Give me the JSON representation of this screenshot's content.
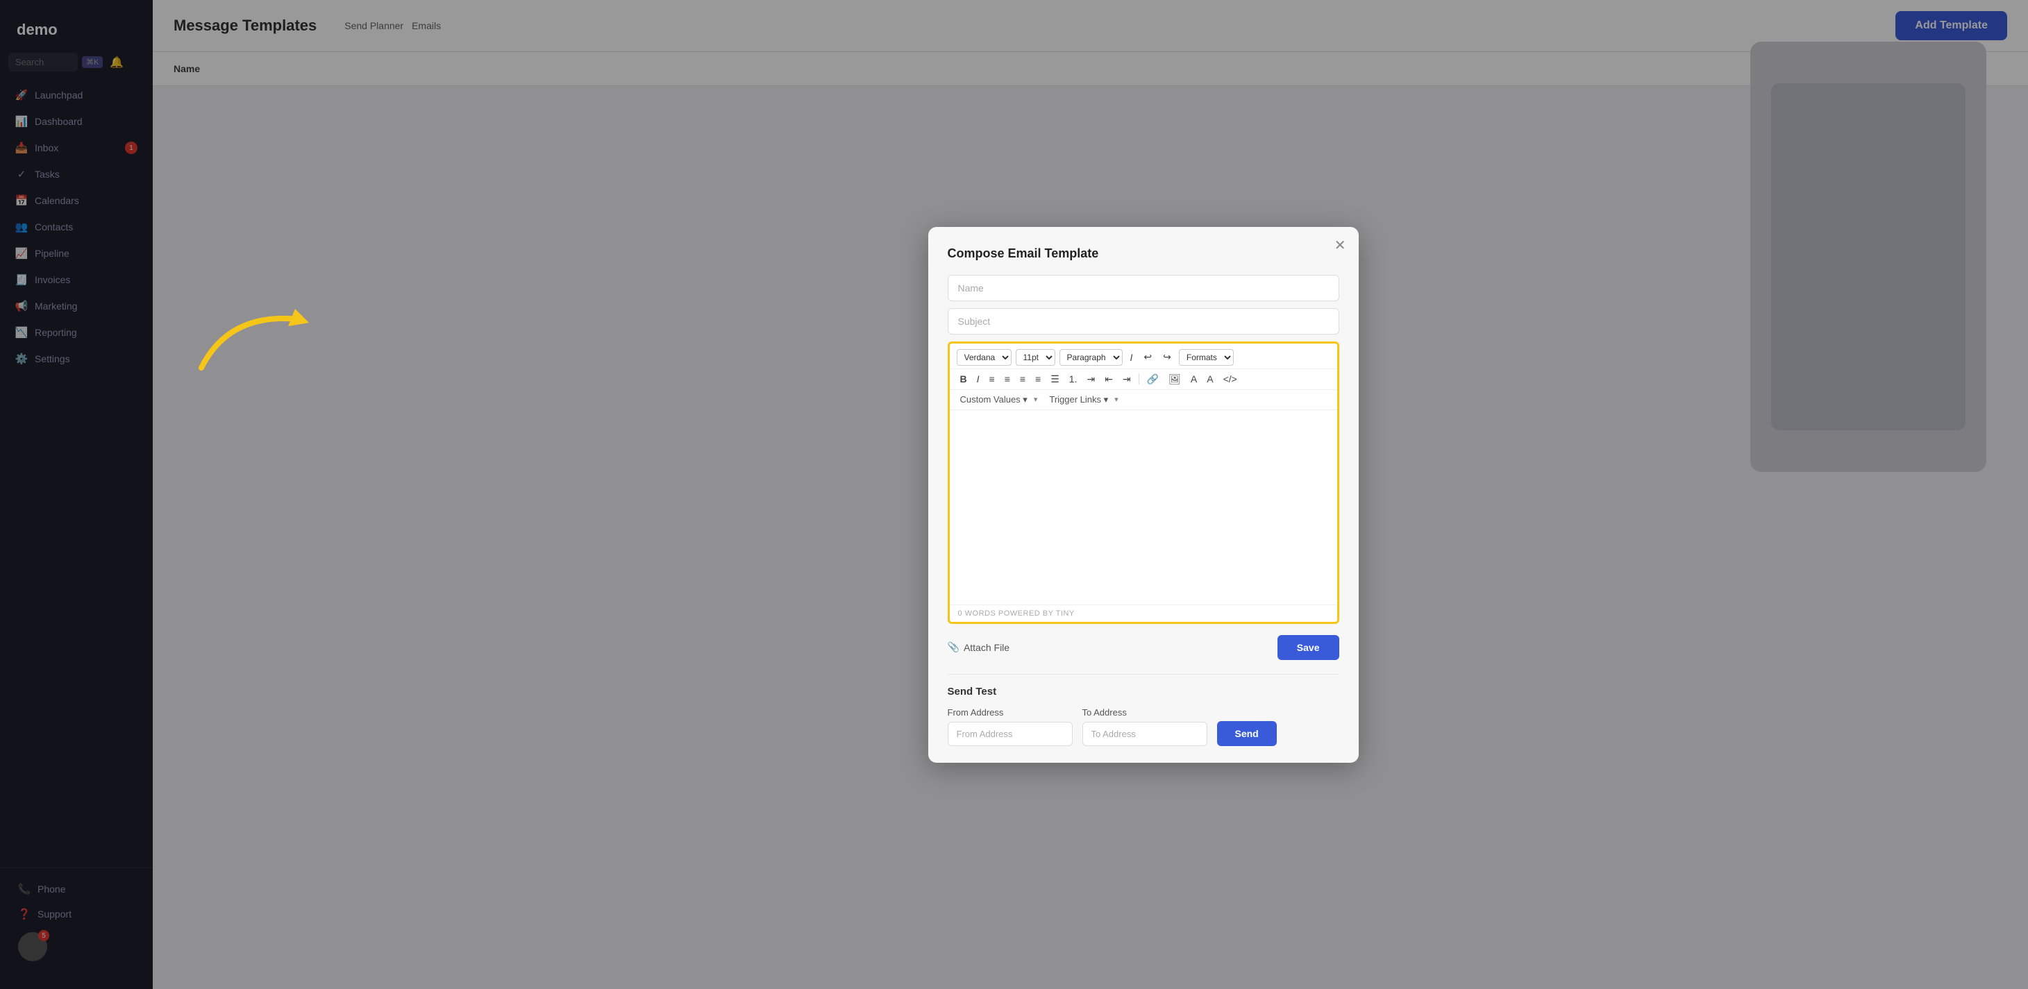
{
  "app": {
    "logo": "demo",
    "page_title": "Message Templates"
  },
  "sidebar": {
    "search_placeholder": "Search",
    "search_badge": "⌘K",
    "items": [
      {
        "id": "launchpad",
        "label": "Launchpad",
        "icon": "🚀"
      },
      {
        "id": "dashboard",
        "label": "Dashboard",
        "icon": "📊"
      },
      {
        "id": "inbox",
        "label": "Inbox",
        "icon": "📥",
        "badge": "1"
      },
      {
        "id": "tasks",
        "label": "Tasks",
        "icon": "✓"
      },
      {
        "id": "calendars",
        "label": "Calendars",
        "icon": "📅"
      },
      {
        "id": "contacts",
        "label": "Contacts",
        "icon": "👥"
      },
      {
        "id": "pipeline",
        "label": "Pipeline",
        "icon": "📈"
      },
      {
        "id": "invoices",
        "label": "Invoices",
        "icon": "🧾"
      },
      {
        "id": "marketing",
        "label": "Marketing",
        "icon": "📢"
      },
      {
        "id": "reporting",
        "label": "Reporting",
        "icon": "📉"
      },
      {
        "id": "settings",
        "label": "Settings",
        "icon": "⚙️"
      }
    ],
    "bottom_items": [
      {
        "id": "phone",
        "label": "Phone",
        "icon": "📞"
      },
      {
        "id": "support",
        "label": "Support",
        "icon": "❓"
      }
    ],
    "avatar_badge": "5"
  },
  "header": {
    "title": "Message Templates",
    "nav": [
      "Send Planner",
      "Emails"
    ],
    "add_button_label": "Add Template"
  },
  "table": {
    "columns": [
      "Name"
    ]
  },
  "modal": {
    "title": "Compose Email Template",
    "name_placeholder": "Name",
    "subject_placeholder": "Subject",
    "toolbar": {
      "font": "Verdana",
      "size": "11pt",
      "paragraph": "Paragraph",
      "formats": "Formats",
      "custom_values": "Custom Values",
      "trigger_links": "Trigger Links"
    },
    "editor_footer": "0 WORDS POWERED BY TINY",
    "attach_label": "Attach File",
    "save_label": "Save"
  },
  "send_test": {
    "title": "Send Test",
    "from_label": "From Address",
    "from_placeholder": "From Address",
    "to_label": "To Address",
    "to_placeholder": "To Address",
    "send_label": "Send"
  }
}
